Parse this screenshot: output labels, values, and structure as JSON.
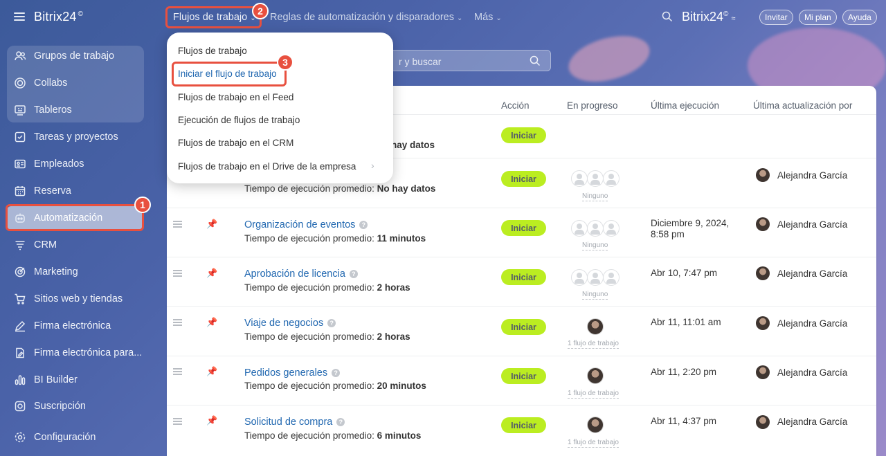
{
  "sidebar": {
    "logo": "Bitrix24",
    "logo_mark": "©",
    "items": [
      {
        "label": "Grupos de trabajo",
        "icon": "people-icon"
      },
      {
        "label": "Collabs",
        "icon": "collab-icon"
      },
      {
        "label": "Tableros",
        "icon": "board-icon"
      },
      {
        "label": "Tareas y proyectos",
        "icon": "checkbox-icon"
      },
      {
        "label": "Empleados",
        "icon": "id-card-icon"
      },
      {
        "label": "Reserva",
        "icon": "calendar-icon"
      },
      {
        "label": "Automatización",
        "icon": "robot-icon"
      },
      {
        "label": "CRM",
        "icon": "crm-icon"
      },
      {
        "label": "Marketing",
        "icon": "marketing-icon"
      },
      {
        "label": "Sitios web y tiendas",
        "icon": "cart-icon"
      },
      {
        "label": "Firma electrónica",
        "icon": "pen-icon"
      },
      {
        "label": "Firma electrónica para...",
        "icon": "document-sign-icon"
      },
      {
        "label": "BI Builder",
        "icon": "bar-chart-icon"
      },
      {
        "label": "Suscripción",
        "icon": "subscription-icon"
      },
      {
        "label": "Configuración",
        "icon": "gear-icon"
      }
    ]
  },
  "topbar": {
    "tabs": [
      "Flujos de trabajo",
      "Reglas de automatización y disparadores",
      "Más"
    ],
    "brand": "Bitrix24",
    "brand_mark": "©",
    "invite": "Invitar",
    "plan": "Mi plan",
    "help": "Ayuda"
  },
  "search": {
    "placeholder": "r y buscar"
  },
  "dropdown": {
    "items": [
      "Flujos de trabajo",
      "Iniciar el flujo de trabajo",
      "Flujos de trabajo en el Feed",
      "Ejecución de flujos de trabajo",
      "Flujos de trabajo en el CRM",
      "Flujos de trabajo en el Drive de la empresa"
    ]
  },
  "table": {
    "headers": [
      "Acción",
      "En progreso",
      "Última ejecución",
      "Última actualización por"
    ],
    "time_label": "Tiempo de ejecución promedio:",
    "start_label": "Iniciar",
    "row0_partial": "hay datos",
    "rows": [
      {
        "name": "",
        "time": "No hay datos",
        "progress": "Ninguno",
        "last_run": "",
        "updater": "Alejandra García"
      },
      {
        "name": "Organización de eventos",
        "time": "11 minutos",
        "progress": "Ninguno",
        "last_run": "Diciembre 9, 2024, 8:58 pm",
        "updater": "Alejandra García"
      },
      {
        "name": "Aprobación de licencia",
        "time": "2 horas",
        "progress": "Ninguno",
        "last_run": "Abr 10, 7:47 pm",
        "updater": "Alejandra García"
      },
      {
        "name": "Viaje de negocios",
        "time": "2 horas",
        "progress": "1 flujo de trabajo",
        "last_run": "Abr 11, 11:01 am",
        "updater": "Alejandra García"
      },
      {
        "name": "Pedidos generales",
        "time": "20 minutos",
        "progress": "1 flujo de trabajo",
        "last_run": "Abr 11, 2:20 pm",
        "updater": "Alejandra García"
      },
      {
        "name": "Solicitud de compra",
        "time": "6 minutos",
        "progress": "1 flujo de trabajo",
        "last_run": "Abr 11, 4:37 pm",
        "updater": "Alejandra García"
      }
    ]
  },
  "callouts": [
    "1",
    "2",
    "3"
  ],
  "colors": {
    "accent_green": "#bbed21",
    "callout_red": "#e8503f",
    "link_blue": "#2067b0"
  }
}
